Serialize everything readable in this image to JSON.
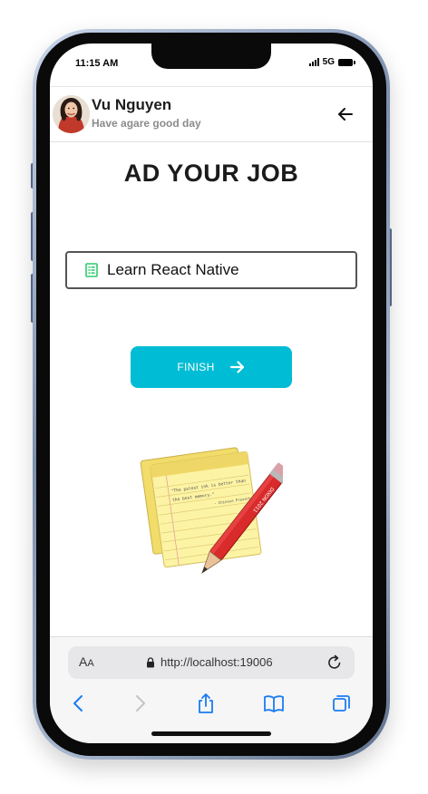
{
  "status_bar": {
    "time": "11:15 AM",
    "network": "5G"
  },
  "header": {
    "user_name": "Vu Nguyen",
    "greeting": "Have agare good day"
  },
  "main": {
    "title": "AD YOUR JOB",
    "job_input_value": "Learn React Native",
    "finish_label": "FINISH"
  },
  "notepad_quote": {
    "line1": "\"The palest ink is better than",
    "line2": "the best memory.\"",
    "attribution": "- Chinese Proverb",
    "pencil_text": "DIXON 2011"
  },
  "browser": {
    "text_size_big": "A",
    "text_size_small": "A",
    "url": "http://localhost:19006"
  },
  "colors": {
    "accent": "#00bcd4",
    "doc_icon": "#2ecc71",
    "toolbar_icon": "#1a7cf2"
  },
  "icons": {
    "back": "arrow-left-icon",
    "document": "document-icon",
    "finish": "arrow-right-icon",
    "lock": "lock-icon",
    "reload": "reload-icon",
    "nav_back": "chevron-left-icon",
    "nav_forward": "chevron-right-icon",
    "share": "share-icon",
    "bookmarks": "book-icon",
    "tabs": "tabs-icon"
  }
}
